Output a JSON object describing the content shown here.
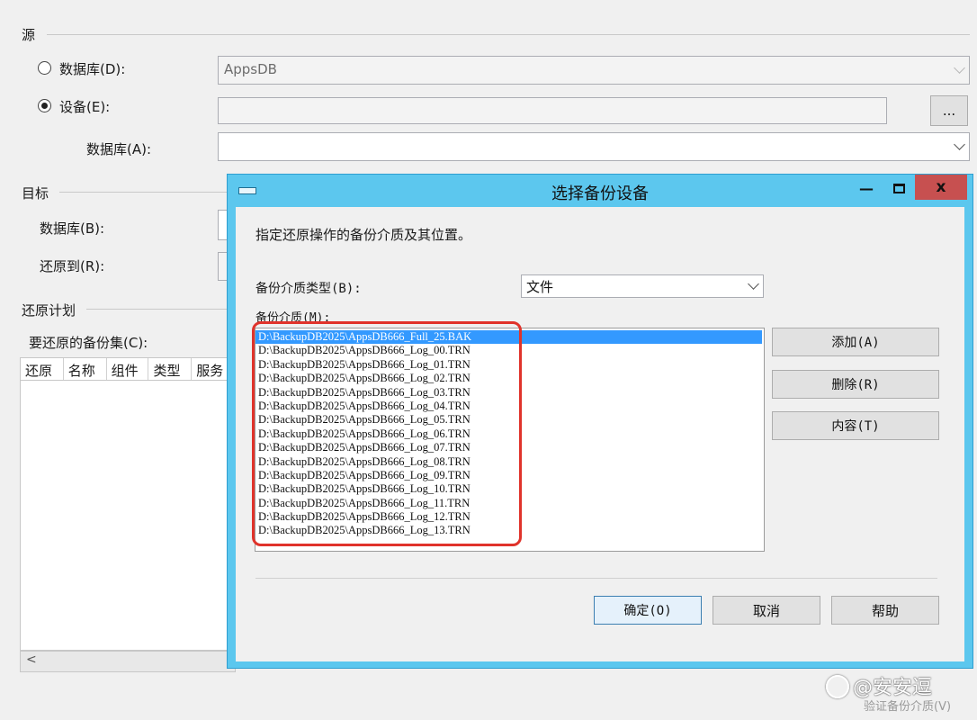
{
  "source": {
    "title": "源",
    "database_radio_label": "数据库(D):",
    "database_value": "AppsDB",
    "device_radio_label": "设备(E):",
    "device_value": "",
    "browse_button": "...",
    "device_database_label": "数据库(A):",
    "device_database_value": ""
  },
  "target": {
    "title": "目标",
    "database_label": "数据库(B):",
    "restore_to_label": "还原到(R):"
  },
  "plan": {
    "title": "还原计划",
    "backup_sets_label": "要还原的备份集(C):",
    "columns": [
      "还原",
      "名称",
      "组件",
      "类型",
      "服务"
    ],
    "scroll_left": "<"
  },
  "dialog": {
    "title": "选择备份设备",
    "minimize": "—",
    "maximize": "□",
    "close": "x",
    "instruction": "指定还原操作的备份介质及其位置。",
    "media_type_label": "备份介质类型(B):",
    "media_type_value": "文件",
    "media_label": "备份介质(M):",
    "media_items": [
      "D:\\BackupDB2025\\AppsDB666_Full_25.BAK",
      "D:\\BackupDB2025\\AppsDB666_Log_00.TRN",
      "D:\\BackupDB2025\\AppsDB666_Log_01.TRN",
      "D:\\BackupDB2025\\AppsDB666_Log_02.TRN",
      "D:\\BackupDB2025\\AppsDB666_Log_03.TRN",
      "D:\\BackupDB2025\\AppsDB666_Log_04.TRN",
      "D:\\BackupDB2025\\AppsDB666_Log_05.TRN",
      "D:\\BackupDB2025\\AppsDB666_Log_06.TRN",
      "D:\\BackupDB2025\\AppsDB666_Log_07.TRN",
      "D:\\BackupDB2025\\AppsDB666_Log_08.TRN",
      "D:\\BackupDB2025\\AppsDB666_Log_09.TRN",
      "D:\\BackupDB2025\\AppsDB666_Log_10.TRN",
      "D:\\BackupDB2025\\AppsDB666_Log_11.TRN",
      "D:\\BackupDB2025\\AppsDB666_Log_12.TRN",
      "D:\\BackupDB2025\\AppsDB666_Log_13.TRN"
    ],
    "add_button": "添加(A)",
    "remove_button": "删除(R)",
    "contents_button": "内容(T)",
    "ok_button": "确定(O)",
    "cancel_button": "取消",
    "help_button": "帮助"
  },
  "watermark": {
    "text": "@安安逗",
    "subtext": "验证备份介质(V)"
  },
  "colors": {
    "dialog_frame": "#5cc7ee",
    "close_button": "#c75050",
    "selection": "#3399ff",
    "highlight_box": "#e0332b"
  }
}
